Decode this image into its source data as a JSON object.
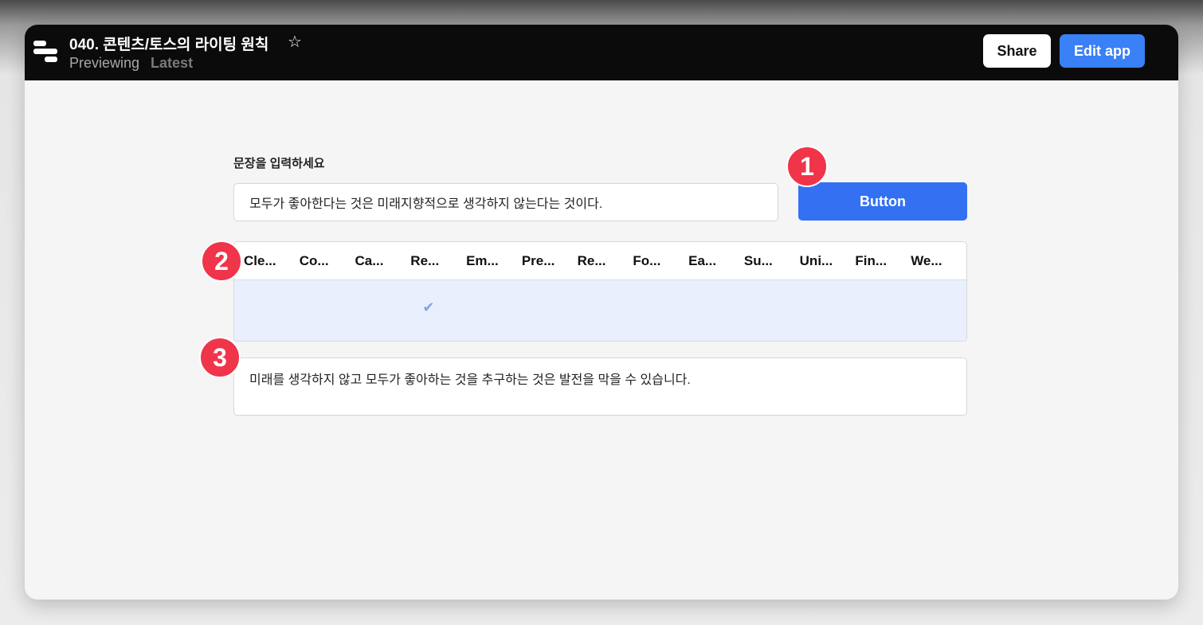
{
  "header": {
    "title": "040. 콘텐츠/토스의 라이팅 원칙",
    "status": "Previewing",
    "version": "Latest",
    "share_label": "Share",
    "edit_label": "Edit app"
  },
  "form": {
    "label": "문장을 입력하세요",
    "input_value": "모두가 좋아한다는 것은 미래지향적으로 생각하지 않는다는 것이다.",
    "button_label": "Button"
  },
  "table": {
    "columns": [
      "Cle...",
      "Co...",
      "Ca...",
      "Re...",
      "Em...",
      "Pre...",
      "Re...",
      "Fo...",
      "Ea...",
      "Su...",
      "Uni...",
      "Fin...",
      "We..."
    ],
    "checked_column": 3
  },
  "output": {
    "text": "미래를 생각하지 않고 모두가 좋아하는 것을 추구하는 것은 발전을 막을 수 있습니다."
  },
  "badges": [
    "1",
    "2",
    "3"
  ]
}
